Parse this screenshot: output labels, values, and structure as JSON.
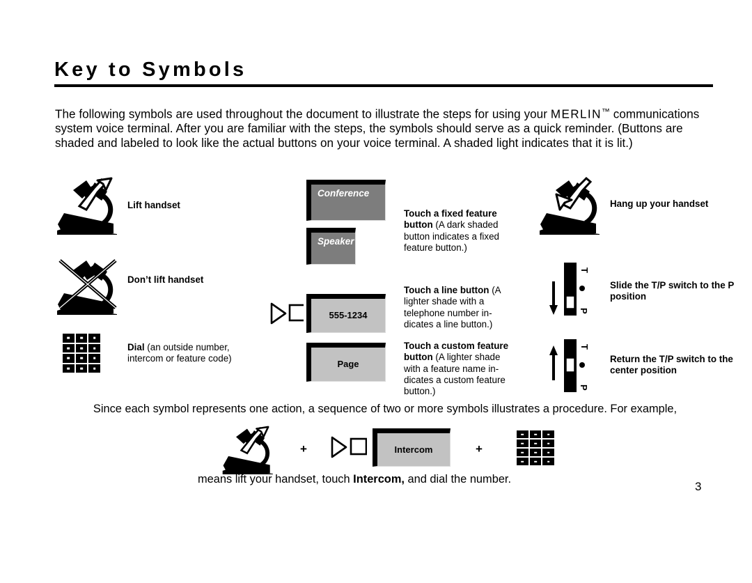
{
  "page": {
    "title": "Key to Symbols",
    "number": "3",
    "intro": {
      "before_brand": "The following symbols are used throughout the document to illustrate the steps for using your ",
      "brand": "MERLIN",
      "trademark": "™",
      "after_brand": " communications system voice terminal. After you are familiar with the steps, the symbols should serve as a quick reminder. (Buttons are shaded and labeled to look like the actual buttons on your voice terminal. A shaded light indicates that it is lit.)"
    }
  },
  "symbols": {
    "lift_handset": {
      "icon": "handset-lift-icon",
      "label": "Lift handset"
    },
    "dont_lift_handset": {
      "icon": "handset-no-lift-icon",
      "label": "Don’t lift handset"
    },
    "dial": {
      "icon": "dialpad-icon",
      "label_bold": "Dial",
      "label_rest": " (an outside number, intercom or feature code)"
    },
    "fixed_feature": {
      "buttons": [
        {
          "caption": "Conference",
          "style": "fixed"
        },
        {
          "caption": "Speaker",
          "style": "fixed"
        }
      ],
      "label_bold": "Touch a fixed feature button",
      "label_rest": " (A dark shaded button indicates a fixed feature  button.)"
    },
    "line_button": {
      "glyph": "touch-triangle-square-icon",
      "button": {
        "caption": "555-1234",
        "style": "custom"
      },
      "label_bold": "Touch a line button",
      "label_rest": " (A lighter shade with a telephone number in-dicates a line button.)"
    },
    "custom_feature": {
      "button": {
        "caption": "Page",
        "style": "custom"
      },
      "label_bold": "Touch a custom feature button",
      "label_rest": " (A lighter shade with a feature name in-dicates a custom feature button.)"
    },
    "hang_up": {
      "icon": "handset-hangup-icon",
      "label": "Hang up your handset"
    },
    "slide_tp": {
      "icon": "tp-switch-p-icon",
      "arrow": "arrow-down-icon",
      "top_label": "T",
      "bottom_label": "P",
      "label": "Slide the T/P switch to the P position"
    },
    "return_tp": {
      "icon": "tp-switch-center-icon",
      "arrow": "arrow-up-icon",
      "top_label": "T",
      "bottom_label": "P",
      "label": "Return the T/P switch to the center position"
    }
  },
  "example": {
    "intro": "Since each symbol represents one action, a sequence of two or more symbols illustrates a procedure.  For example,",
    "plus": "+",
    "button": {
      "caption": "Intercom",
      "style": "custom"
    },
    "means_before": "means lift your handset, touch ",
    "means_bold": "Intercom,",
    "means_after": " and dial the number."
  },
  "colors": {
    "fixed_button_fill": "#7d7d7d",
    "custom_button_fill": "#c2c2c2",
    "ink": "#000000",
    "page_background": "#ffffff"
  }
}
